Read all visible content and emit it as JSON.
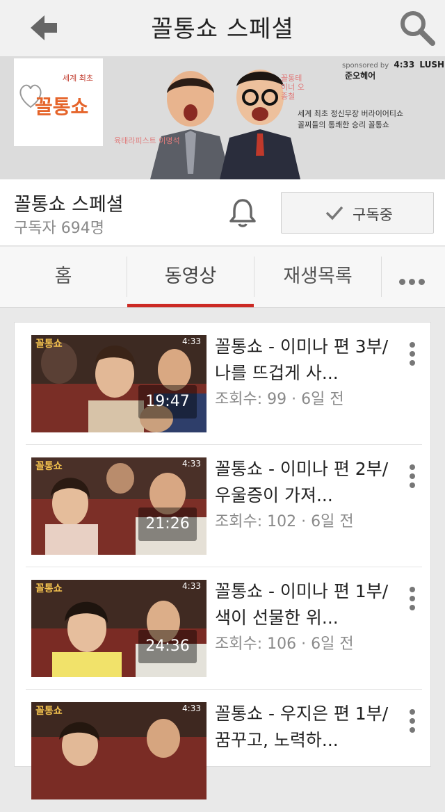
{
  "appbar": {
    "title": "꼴통쇼 스페셜",
    "back_icon": "back-arrow-icon",
    "search_icon": "search-icon"
  },
  "banner": {
    "logo_text": "꼴통쇼",
    "logo_sub": "세계 최초",
    "sponsor_label": "sponsored by",
    "sponsor_brands": [
      "4:33",
      "LUSH",
      "준오헤어"
    ],
    "slogan_line1": "세계 최초 정신무장 버라이어티쇼",
    "slogan_line2": "꼴찌들의 통쾌한 승리 꼴통쇼",
    "tag_left": "육태라피스트 이명석",
    "tag_right": "꼴통테이너 오종철"
  },
  "channel": {
    "name": "꼴통쇼 스페셜",
    "subscribers": "구독자 694명",
    "bell_icon": "bell-icon",
    "subscribe_label": "구독중",
    "check_icon": "check-icon"
  },
  "tabs": [
    {
      "label": "홈",
      "active": false
    },
    {
      "label": "동영상",
      "active": true
    },
    {
      "label": "재생목록",
      "active": false
    }
  ],
  "tabs_more_icon": "more-horizontal-icon",
  "colors": {
    "accent": "#cc2a24",
    "appbar_bg": "#f1f1f1",
    "meta_text": "#8a8a8a"
  },
  "videos": [
    {
      "title": "꼴통쇼 - 이미나 편 3부/나를 뜨겁게 사...",
      "meta": "조회수: 99 · 6일 전",
      "duration": "19:47"
    },
    {
      "title": "꼴통쇼 - 이미나 편 2부/우울증이 가져...",
      "meta": "조회수: 102 · 6일 전",
      "duration": "21:26"
    },
    {
      "title": "꼴통쇼 - 이미나 편 1부/색이 선물한 위...",
      "meta": "조회수: 106 · 6일 전",
      "duration": "24:36"
    },
    {
      "title": "꼴통쇼 - 우지은 편 1부/꿈꾸고, 노력하...",
      "meta": "",
      "duration": ""
    }
  ],
  "thumb_overlay": {
    "tag": "꼴통쇼",
    "brand": "4:33"
  }
}
